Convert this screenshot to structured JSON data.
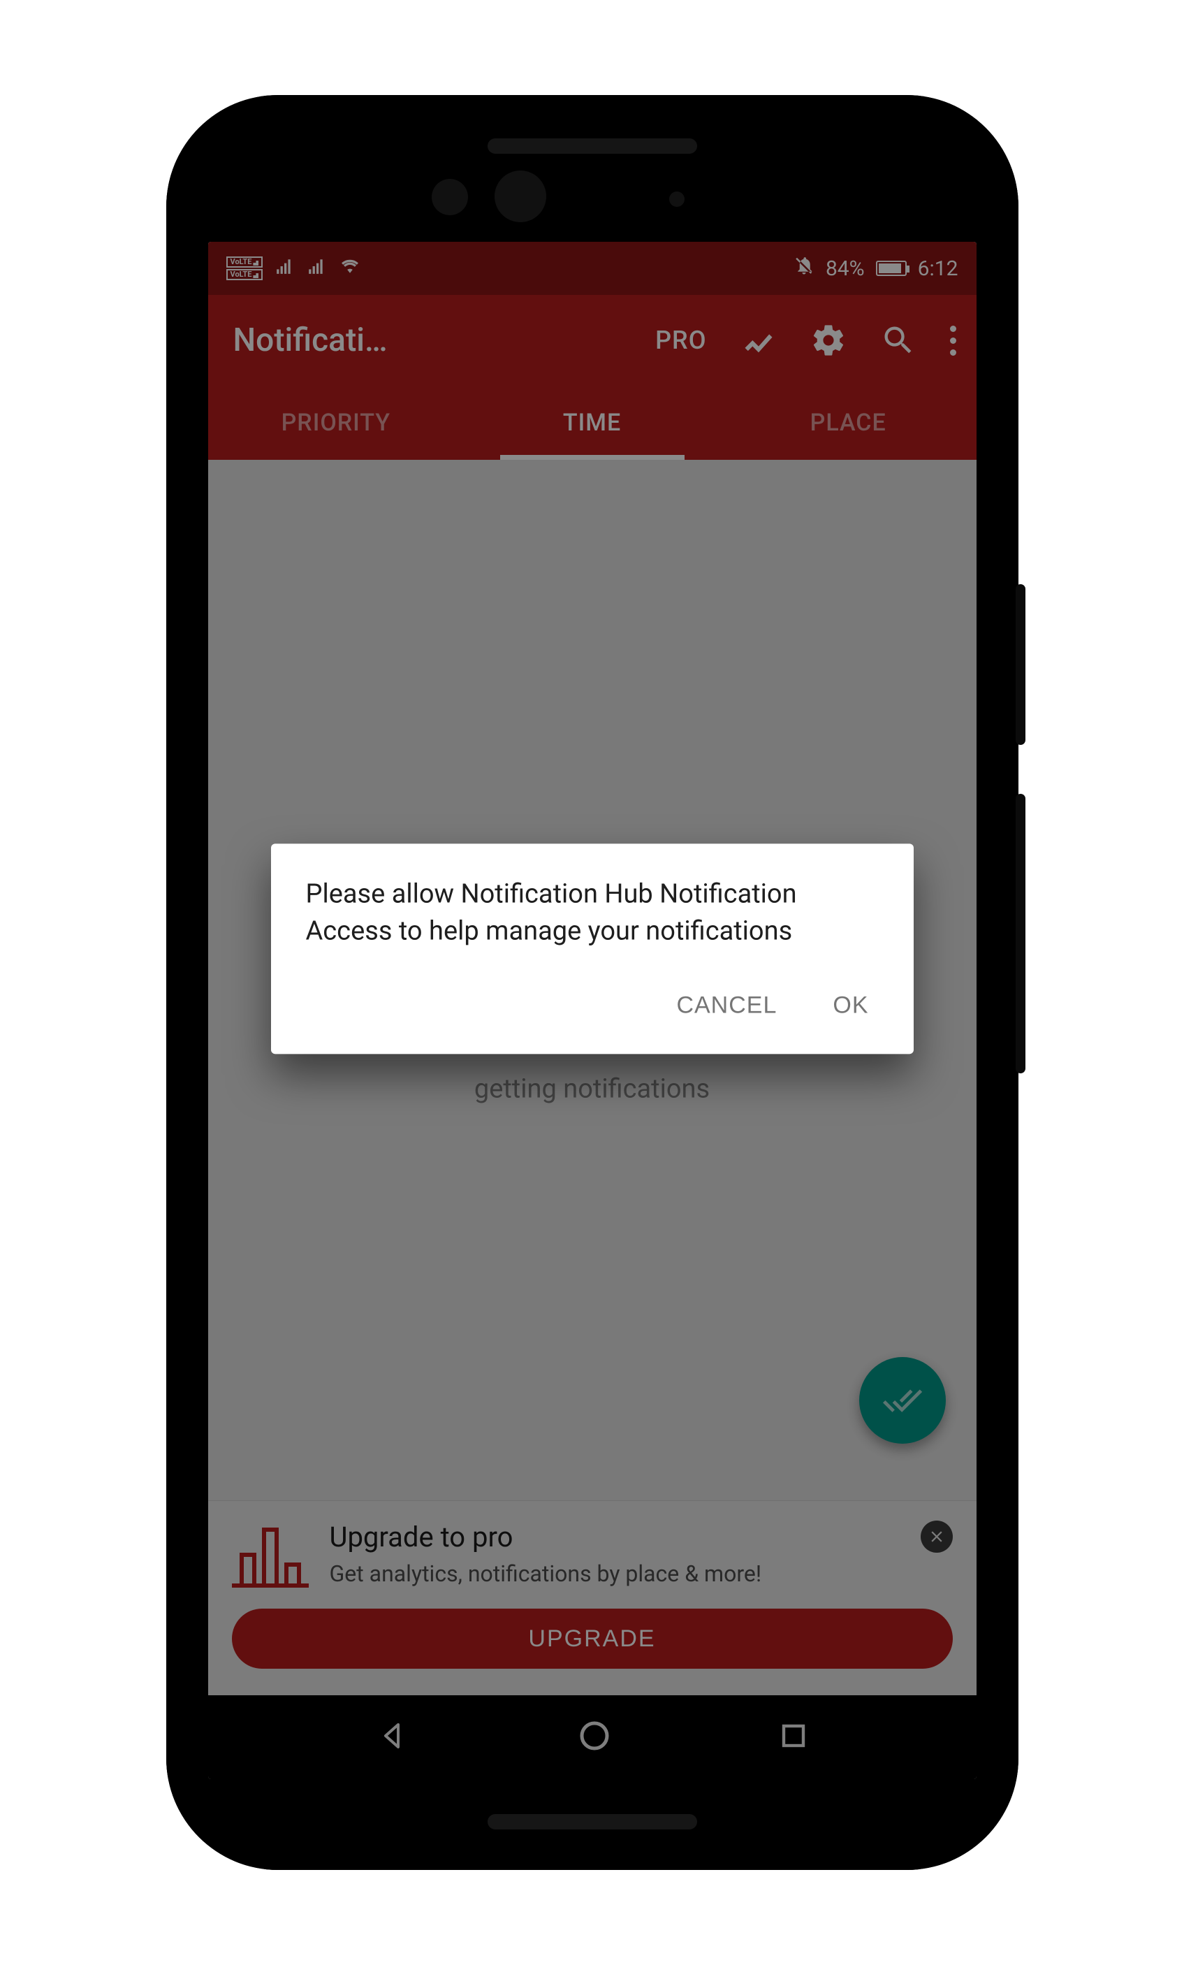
{
  "statusbar": {
    "volte1": "VoLTE",
    "volte2": "VoLTE",
    "battery_pct": "84%",
    "time": "6:12"
  },
  "appbar": {
    "title": "Notificati…",
    "pro_label": "PRO"
  },
  "tabs": {
    "priority": "PRIORITY",
    "time": "TIME",
    "place": "PLACE",
    "active": "time"
  },
  "placeholder": "getting notifications",
  "upgrade": {
    "title": "Upgrade to pro",
    "subtitle": "Get analytics, notifications by place & more!",
    "button": "UPGRADE"
  },
  "dialog": {
    "message": "Please allow Notification Hub Notification Access to help manage your notifications",
    "cancel": "CANCEL",
    "ok": "OK"
  }
}
